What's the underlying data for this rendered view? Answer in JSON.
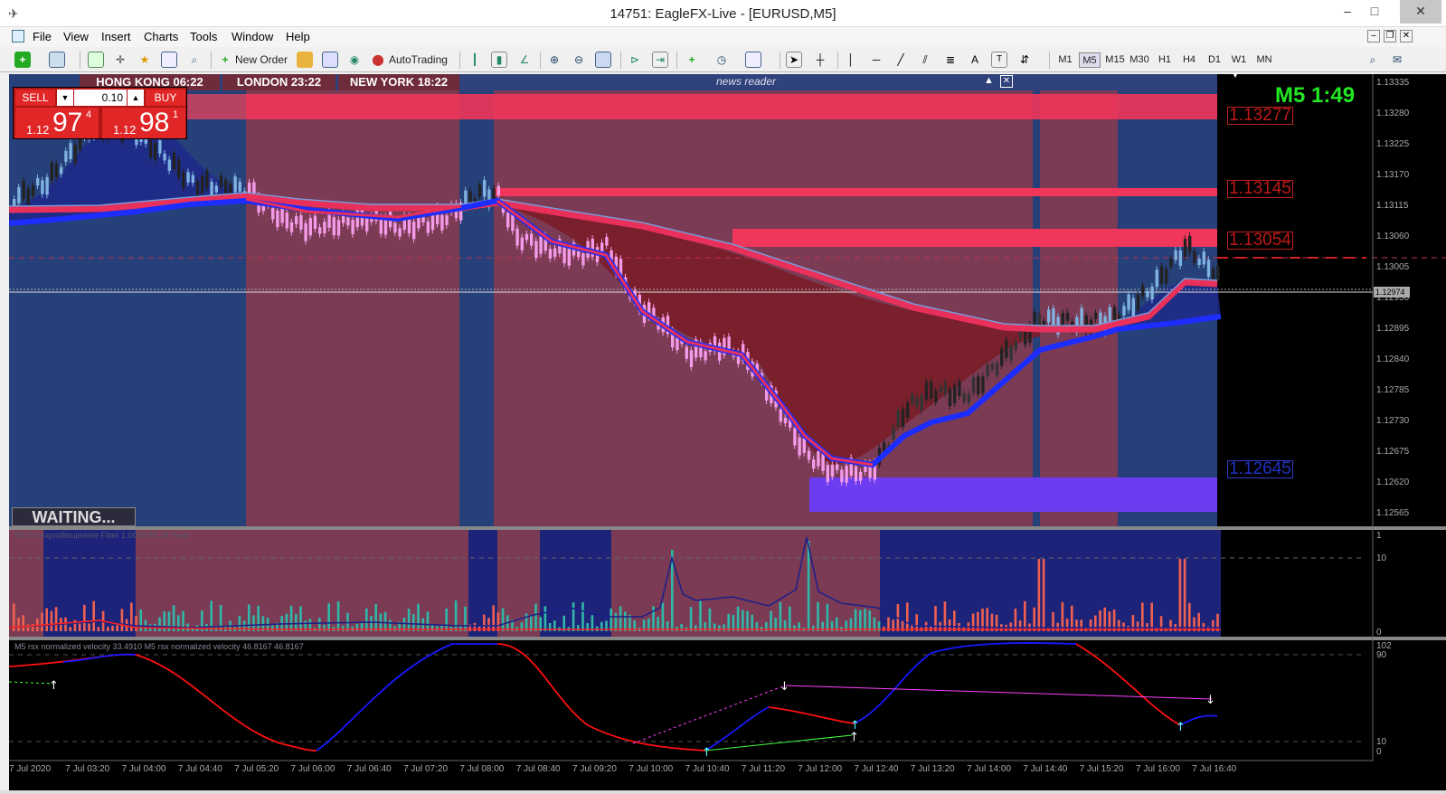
{
  "window": {
    "title": "14751: EagleFX-Live - [EURUSD,M5]"
  },
  "menu": [
    "File",
    "View",
    "Insert",
    "Charts",
    "Tools",
    "Window",
    "Help"
  ],
  "toolbar": {
    "new_order": "New Order",
    "autotrading": "AutoTrading",
    "timeframes": [
      "M1",
      "M5",
      "M15",
      "M30",
      "H1",
      "H4",
      "D1",
      "W1",
      "MN"
    ],
    "active_tf": "M5"
  },
  "sessions": {
    "hk": "HONG KONG 06:22",
    "london": "LONDON  23:22",
    "ny": "NEW YORK 18:22",
    "news": "news reader"
  },
  "trade": {
    "sell": "SELL",
    "buy": "BUY",
    "lot": "0.10",
    "sell_small": "1.12",
    "sell_big": "97",
    "sell_sup": "4",
    "buy_small": "1.12",
    "buy_big": "98",
    "buy_sup": "1"
  },
  "timer": "M5 1:49",
  "status": "WAITING...",
  "levels": [
    {
      "price": 1.13277,
      "label": "1.13277"
    },
    {
      "price": 1.13145,
      "label": "1.13145"
    },
    {
      "price": 1.13054,
      "label": "1.13054"
    },
    {
      "price": 1.12645,
      "label": "1.12645"
    }
  ],
  "price_axis": [
    "1.13335",
    "1.13280",
    "1.13225",
    "1.13170",
    "1.13115",
    "1.13060",
    "1.13005",
    "1.12950",
    "1.12895",
    "1.12840",
    "1.12785",
    "1.12730",
    "1.12675",
    "1.12620",
    "1.12565"
  ],
  "current_price": "1.12974",
  "ind1": {
    "label": "M5 Forexprofitsupreme Filter 1.0000 88.18 Peak",
    "axis": [
      "1",
      "10",
      "0"
    ]
  },
  "ind2": {
    "label": "M5 rsx normalized velocity 33.4910  M5 rsx normalized velocity 46.8167 46.8167",
    "axis": [
      "102",
      "90",
      "10",
      "0"
    ]
  },
  "time_axis": [
    "7 Jul 2020",
    "7 Jul 03:20",
    "7 Jul 04:00",
    "7 Jul 04:40",
    "7 Jul 05:20",
    "7 Jul 06:00",
    "7 Jul 06:40",
    "7 Jul 07:20",
    "7 Jul 08:00",
    "7 Jul 08:40",
    "7 Jul 09:20",
    "7 Jul 10:00",
    "7 Jul 10:40",
    "7 Jul 11:20",
    "7 Jul 12:00",
    "7 Jul 12:40",
    "7 Jul 13:20",
    "7 Jul 14:00",
    "7 Jul 14:40",
    "7 Jul 15:20",
    "7 Jul 16:00",
    "7 Jul 16:40"
  ],
  "colors": {
    "resist": "#f0365a",
    "support": "#6b3cf0",
    "ema_fast": "#1d2cff",
    "ema_slow": "#e8305a",
    "bull": "#7fb2e0",
    "bear": "#f39ae8"
  }
}
